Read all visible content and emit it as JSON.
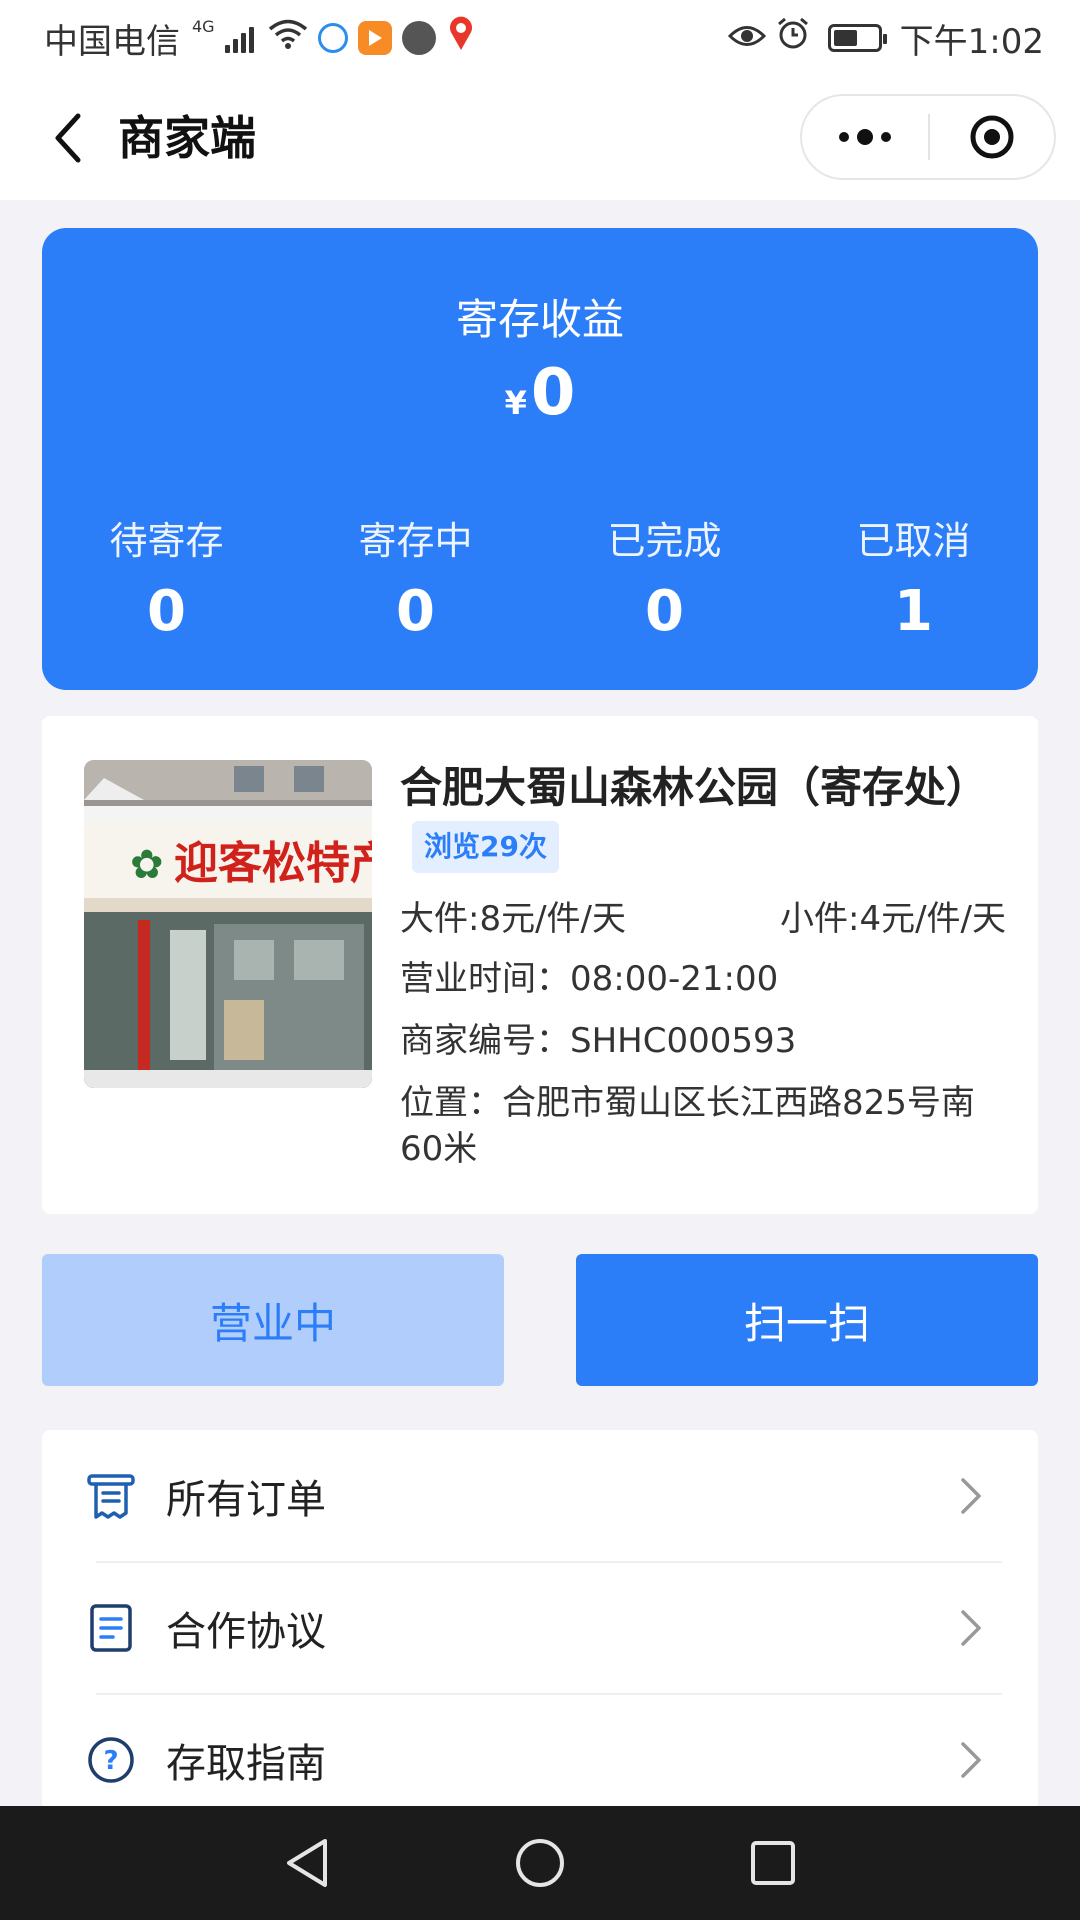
{
  "status_bar": {
    "carrier": "中国电信",
    "network": "4G",
    "time": "下午1:02",
    "battery_level": 0.55
  },
  "nav": {
    "title": "商家端",
    "back_icon": "chevron-left-icon",
    "more_icon": "more-dots-icon",
    "close_icon": "target-icon"
  },
  "income": {
    "title": "寄存收益",
    "currency": "¥",
    "amount": "0",
    "stats": [
      {
        "label": "待寄存",
        "value": "0"
      },
      {
        "label": "寄存中",
        "value": "0"
      },
      {
        "label": "已完成",
        "value": "0"
      },
      {
        "label": "已取消",
        "value": "1"
      }
    ]
  },
  "shop": {
    "photo_sign_text": "迎客松特产",
    "name": "合肥大蜀山森林公园（寄存处）",
    "views": "浏览29次",
    "large_price": "大件:8元/件/天",
    "small_price": "小件:4元/件/天",
    "hours": "营业时间：08:00-21:00",
    "merchant_no": "商家编号：SHHC000593",
    "location": "位置：合肥市蜀山区长江西路825号南60米"
  },
  "buttons": {
    "status": "营业中",
    "scan": "扫一扫"
  },
  "menu": [
    {
      "label": "所有订单",
      "icon": "receipt-icon"
    },
    {
      "label": "合作协议",
      "icon": "document-icon"
    },
    {
      "label": "存取指南",
      "icon": "help-icon"
    }
  ],
  "colors": {
    "accent": "#2c7ef8",
    "accent_light": "#b1cdfb",
    "background": "#f3f3f7"
  }
}
